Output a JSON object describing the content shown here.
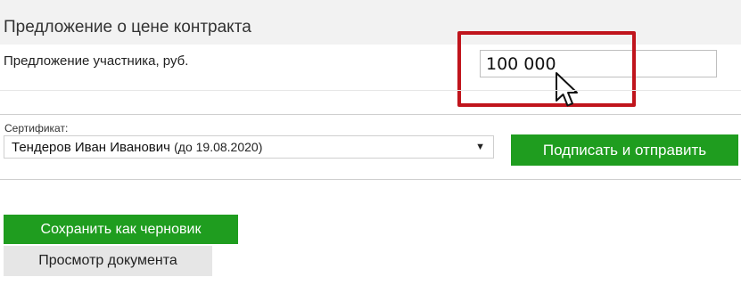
{
  "section": {
    "title": "Предложение о цене контракта"
  },
  "price_offer": {
    "label": "Предложение участника, руб.",
    "value": "100 000"
  },
  "certificate": {
    "label": "Сертификат:",
    "selected_name": "Тендеров Иван Иванович",
    "selected_validity": "(до 19.08.2020)",
    "chevron_glyph": "▼"
  },
  "actions": {
    "sign_label": "Подписать и отправить",
    "draft_label": "Сохранить как черновик",
    "preview_label": "Просмотр документа"
  },
  "colors": {
    "accent_green": "#1f9d1f",
    "highlight_red": "#c0141c",
    "header_bg": "#f2f2f2"
  }
}
